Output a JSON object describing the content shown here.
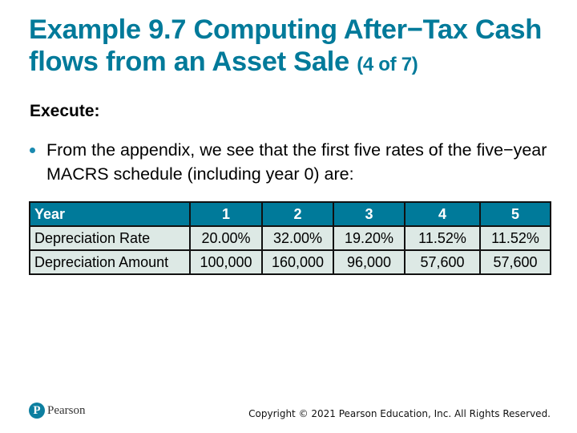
{
  "slide": {
    "title_main": "Example 9.7 Computing After−Tax Cash flows from an Asset Sale",
    "title_suffix": "(4 of 7)",
    "section_label": "Execute:",
    "bullet": "From the appendix, we see that the first five rates of the five−year MACRS schedule (including year 0) are:"
  },
  "table": {
    "header": [
      "Year",
      "1",
      "2",
      "3",
      "4",
      "5"
    ],
    "rows": [
      {
        "label": "Depreciation Rate",
        "values": [
          "20.00%",
          "32.00%",
          "19.20%",
          "11.52%",
          "11.52%"
        ]
      },
      {
        "label": "Depreciation Amount",
        "values": [
          "100,000",
          "160,000",
          "96,000",
          "57,600",
          "57,600"
        ]
      }
    ]
  },
  "footer": {
    "logo_mark": "P",
    "logo_text": "Pearson",
    "copyright": "Copyright © 2021 Pearson Education, Inc. All Rights Reserved."
  },
  "colors": {
    "title": "#007a9a",
    "table_header_bg": "#007a9a",
    "table_body_bg": "#dde9e5",
    "bullet": "#1a8ab0"
  }
}
